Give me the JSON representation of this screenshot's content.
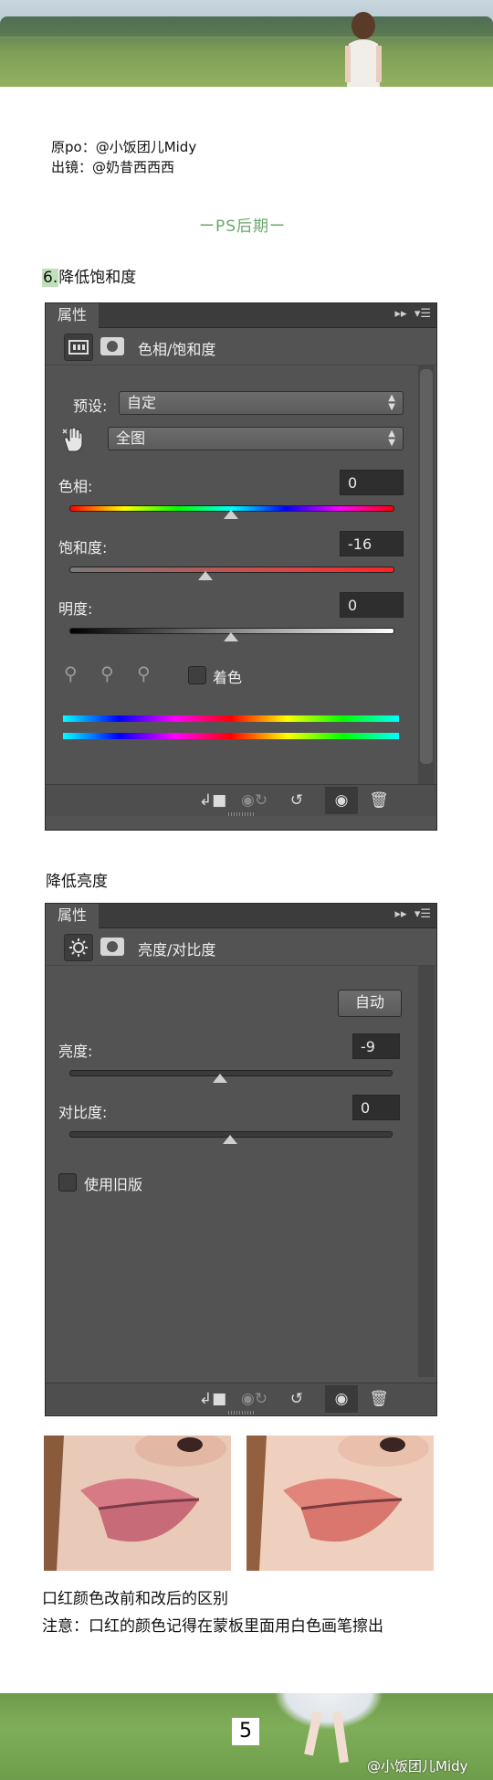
{
  "credits": {
    "line1": "原po：@小饭团儿Midy",
    "line2": "出镜：@奶昔西西西"
  },
  "section_title": "ーPS后期ー",
  "step6": {
    "number": "6.",
    "text": "降低饱和度"
  },
  "hue_panel": {
    "tab": "属性",
    "title": "色相/饱和度",
    "preset_label": "预设:",
    "preset_value": "自定",
    "channel_value": "全图",
    "hue_label": "色相:",
    "hue_value": "0",
    "hue_level": 0.5,
    "sat_label": "饱和度:",
    "sat_value": "-16",
    "sat_level": 0.42,
    "light_label": "明度:",
    "light_value": "0",
    "light_level": 0.5,
    "colorize_label": "着色",
    "colors": {
      "panel": "#535353",
      "field": "#2e2e2e"
    }
  },
  "step_brightness": {
    "text": "降低亮度"
  },
  "bc_panel": {
    "tab": "属性",
    "title": "亮度/对比度",
    "auto_button": "自动",
    "brightness_label": "亮度:",
    "brightness_value": "-9",
    "brightness_level": 0.47,
    "contrast_label": "对比度:",
    "contrast_value": "0",
    "contrast_level": 0.5,
    "legacy_label": "使用旧版"
  },
  "captions": {
    "compare": "口红颜色改前和改后的区别",
    "note": "注意：口红的颜色记得在蒙板里面用白色画笔擦出"
  },
  "footer": {
    "page_number": "5",
    "watermark": "@小饭团儿Midy"
  },
  "icons": [
    "adjustment-layer-icon",
    "mask-icon",
    "hand-target-icon",
    "eyedropper-icon",
    "eyedropper-plus-icon",
    "eyedropper-minus-icon",
    "clip-to-layer-icon",
    "view-previous-icon",
    "reset-icon",
    "visibility-icon",
    "trash-icon",
    "brightness-icon",
    "panel-menu-icon",
    "collapse-icon"
  ]
}
